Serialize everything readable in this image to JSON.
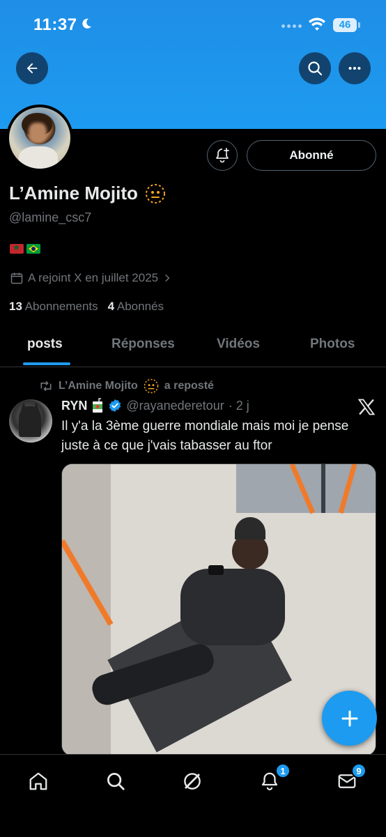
{
  "status_bar": {
    "time": "11:37",
    "battery": "46"
  },
  "profile": {
    "name": "L’Amine Mojito",
    "handle": "@lamine_csc7",
    "follow_label": "Abonné",
    "joined": "A rejoint X en juillet 2025",
    "following_count": "13",
    "following_label": "Abonnements",
    "followers_count": "4",
    "followers_label": "Abonnés"
  },
  "tabs": [
    {
      "label": "posts"
    },
    {
      "label": "Réponses"
    },
    {
      "label": "Vidéos"
    },
    {
      "label": "Photos"
    }
  ],
  "post": {
    "repost_by": "L’Amine Mojito",
    "repost_label": "a reposté",
    "author_name": "RYN",
    "author_handle": "@rayanederetour",
    "age": "· 2 j",
    "text": "Il y'a la 3ème guerre mondiale mais moi je pense juste à ce que j'vais tabasser au ftor"
  },
  "bottom_nav": {
    "notifications_badge": "1",
    "messages_badge": "9"
  },
  "colors": {
    "accent": "#1d9bf0",
    "background": "#000000",
    "muted": "#71767b"
  },
  "icons": [
    "back-arrow-icon",
    "search-icon",
    "more-icon",
    "bell-plus-icon",
    "calendar-icon",
    "chevron-right-icon",
    "repost-icon",
    "verified-icon",
    "x-logo-icon",
    "plus-icon",
    "home-icon",
    "grok-icon",
    "bell-icon",
    "mail-icon"
  ]
}
